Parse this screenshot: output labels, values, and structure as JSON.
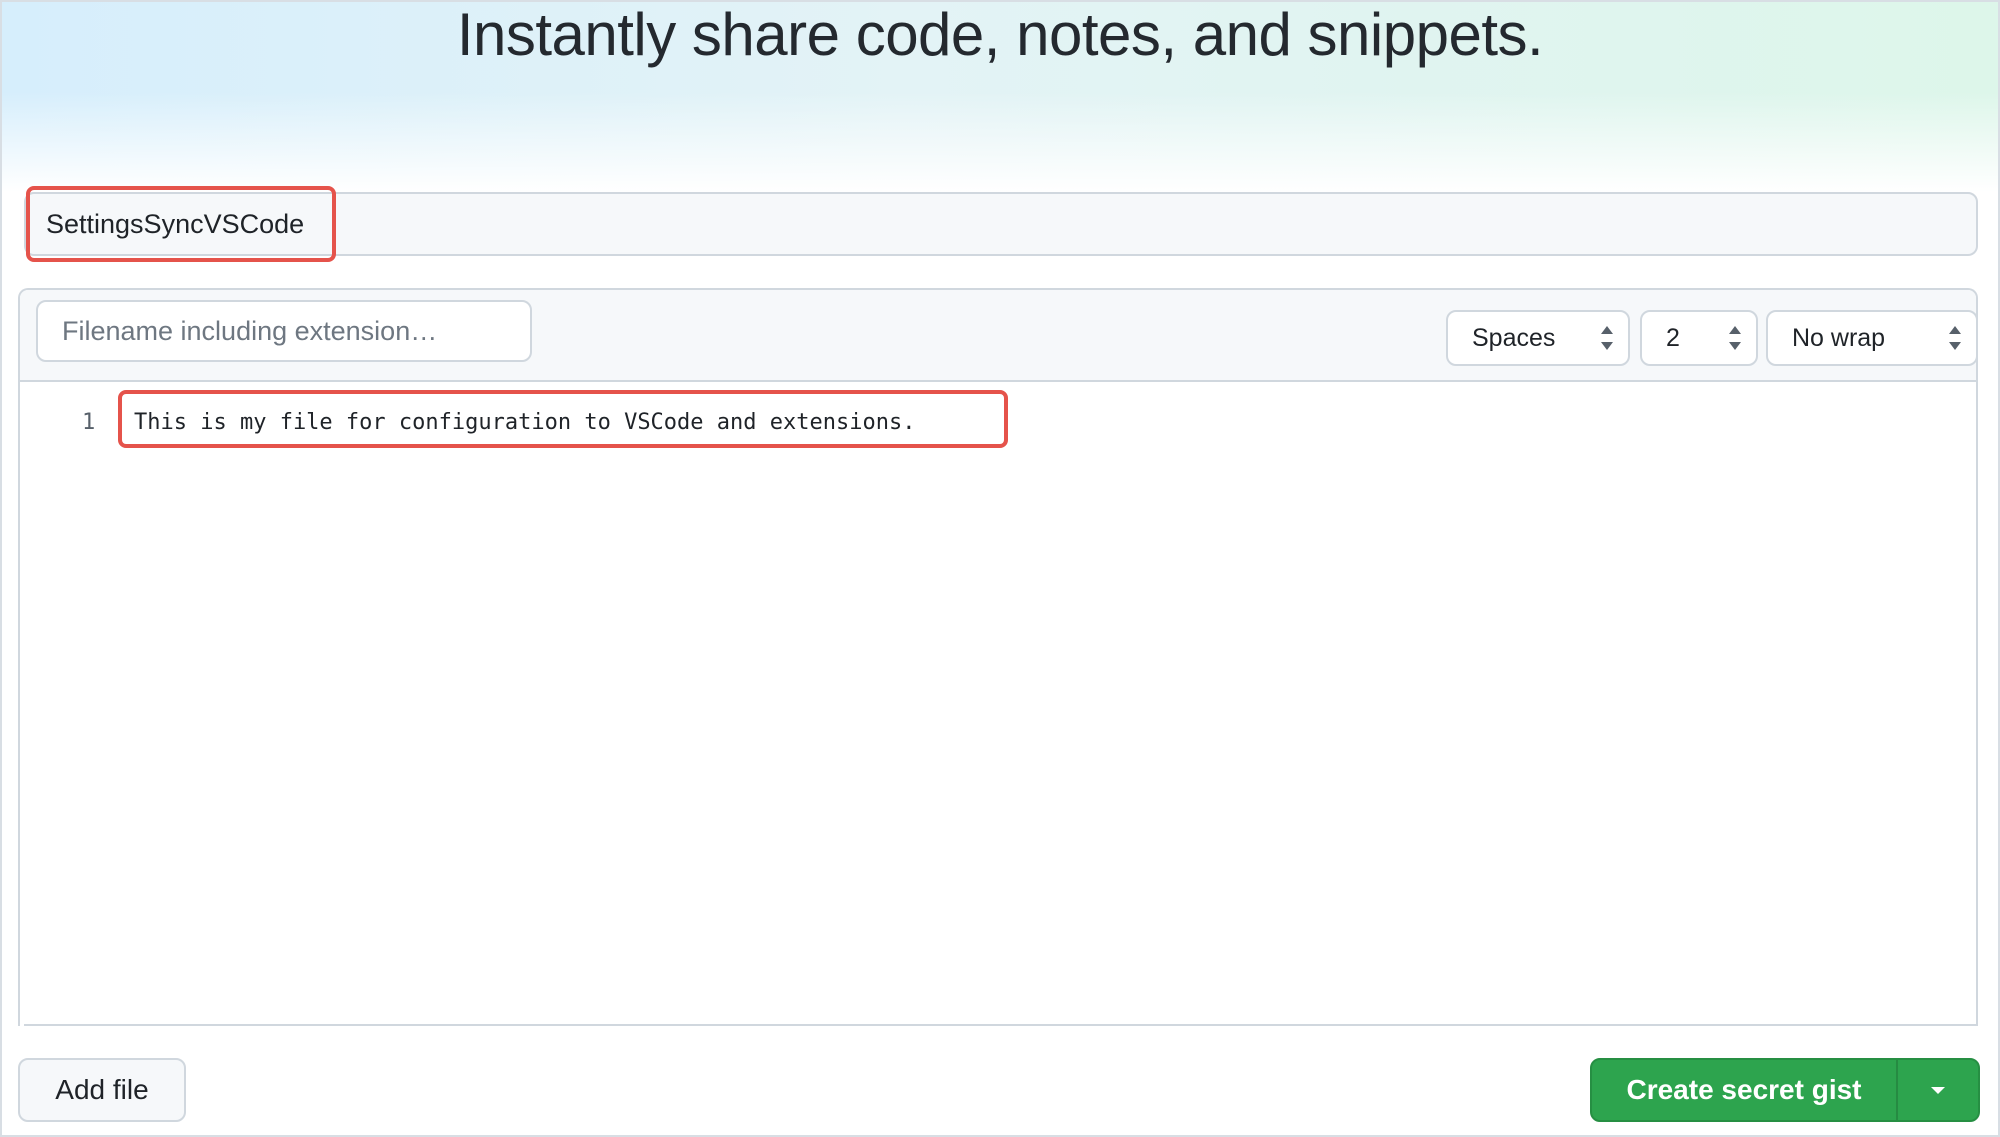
{
  "hero": {
    "title": "Instantly share code, notes, and snippets."
  },
  "gist": {
    "description_value": "SettingsSyncVSCode",
    "filename_placeholder": "Filename including extension…",
    "indent_mode": {
      "selected": "Spaces"
    },
    "indent_size": {
      "selected": "2"
    },
    "wrap_mode": {
      "selected": "No wrap"
    },
    "editor": {
      "lines": [
        {
          "number": "1",
          "text": "This is my file for configuration to VSCode and extensions."
        }
      ]
    }
  },
  "actions": {
    "add_file_label": "Add file",
    "create_label": "Create secret gist"
  },
  "annotations": {
    "highlight_color": "#e5534b"
  },
  "colors": {
    "primary_button": "#2da44e"
  }
}
